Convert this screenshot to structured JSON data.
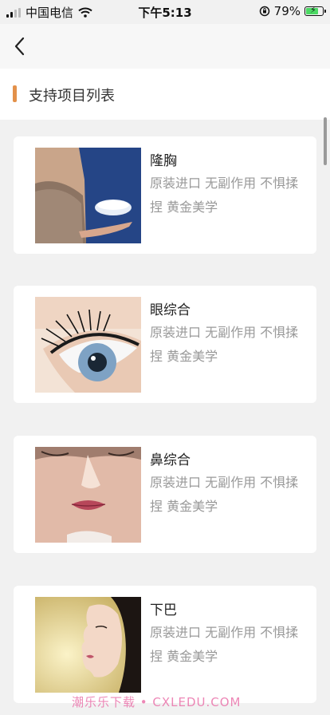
{
  "status_bar": {
    "carrier": "中国电信",
    "time": "下午5:13",
    "battery": "79%",
    "battery_level": 0.79
  },
  "nav": {
    "back_icon": "chevron-left-icon"
  },
  "section": {
    "title": "支持项目列表"
  },
  "items": [
    {
      "title": "隆胸",
      "desc": "原装进口 无副作用 不惧揉捏 黄金美学"
    },
    {
      "title": "眼综合",
      "desc": "原装进口 无副作用 不惧揉捏 黄金美学"
    },
    {
      "title": "鼻综合",
      "desc": "原装进口 无副作用 不惧揉捏 黄金美学"
    },
    {
      "title": "下巴",
      "desc": "原装进口 无副作用 不惧揉捏 黄金美学"
    }
  ],
  "watermark": "潮乐乐下载 • CXLEDU.COM",
  "colors": {
    "accent": "#e3914a",
    "background": "#f1f1f1",
    "card": "#ffffff"
  }
}
